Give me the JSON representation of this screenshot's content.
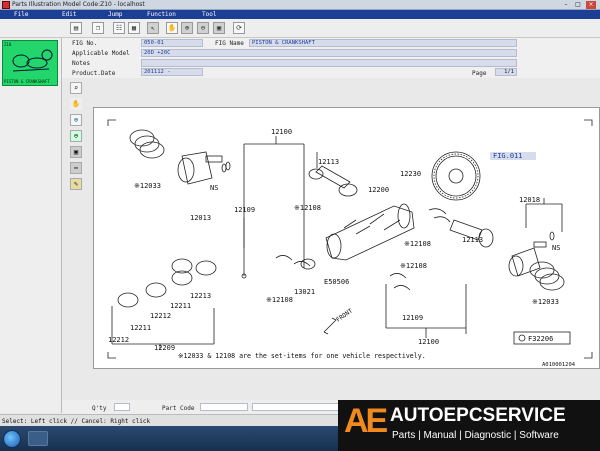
{
  "window": {
    "title": "Parts Illustration Model Code:Z10 - localhost"
  },
  "menu": [
    {
      "label": "File"
    },
    {
      "label": "Edit"
    },
    {
      "label": "Jump"
    },
    {
      "label": "Function"
    },
    {
      "label": "Tool"
    }
  ],
  "thumbnail": {
    "label": "Z10",
    "caption": "PISTON & CRANKSHAFT"
  },
  "info": {
    "fig_no_label": "FIG No.",
    "fig_no_value": "050-01",
    "fig_name_label": "FIG Name",
    "fig_name_value": "PISTON & CRANKSHAFT",
    "model_label": "Applicable Model",
    "model_value": "20D +20C",
    "notes_label": "Notes",
    "notes_value": "",
    "date_label": "Product.Date",
    "date_value": "201112 -",
    "page_label": "Page",
    "page_value": "1/1"
  },
  "diagram": {
    "fig_ref": "FIG.011",
    "footnote": "※12033 & 12108 are the set-items for one vehicle respectively.",
    "fig_code": "F32206",
    "drawing_no": "A010001204",
    "front": "FRONT",
    "labels": {
      "l12100": "12100",
      "l12113a": "12113",
      "l12033a": "※12033",
      "l12013": "12013",
      "l12109a": "12109",
      "l12108a": "※12108",
      "l12200": "12200",
      "l12230": "12230",
      "l12108b": "※12108",
      "l12113b": "12113",
      "l12018": "12018",
      "ns1": "NS",
      "ns2": "NS",
      "l12033b": "※12033",
      "e50506": "E50506",
      "l13021": "13021",
      "l12108c": "※12108",
      "l12108d": "※12108",
      "l12109b": "12109",
      "l12100b": "12100",
      "l12213": "12213",
      "l12211a": "12211",
      "l12212a": "12212",
      "l12211b": "12211",
      "l12212b": "12212",
      "l12209": "12209"
    }
  },
  "bottom": {
    "qty_label": "Q'ty",
    "part_code_label": "Part Code"
  },
  "status": {
    "text": "Select: Left click // Cancel: Right click"
  },
  "watermark": {
    "logo": "AE",
    "name": "AUTOEPCSERVICE",
    "tagline": "Parts | Manual | Diagnostic | Software"
  },
  "colors": {
    "menubar": "#1c3f96",
    "thumbnail": "#22d66c",
    "field": "#d6dceb",
    "accent": "#f08a1c"
  }
}
